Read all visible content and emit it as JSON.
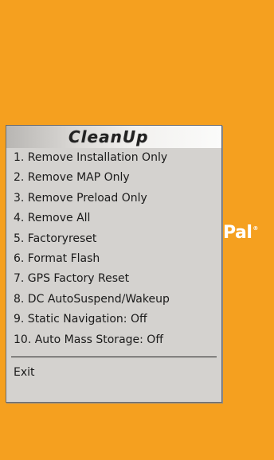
{
  "background": {
    "color": "#f5a01f",
    "logo_text": "Pal",
    "logo_mark": "®"
  },
  "menu": {
    "title": "CleanUp",
    "items": [
      {
        "label": "1. Remove Installation Only"
      },
      {
        "label": "2. Remove MAP Only"
      },
      {
        "label": "3. Remove Preload Only"
      },
      {
        "label": "4. Remove All"
      },
      {
        "label": "5. Factoryreset"
      },
      {
        "label": "6. Format Flash"
      },
      {
        "label": "7. GPS Factory Reset"
      },
      {
        "label": "8. DC AutoSuspend/Wakeup"
      },
      {
        "label": "9. Static Navigation: Off"
      },
      {
        "label": "10. Auto Mass Storage: Off"
      }
    ],
    "exit_label": "Exit"
  }
}
